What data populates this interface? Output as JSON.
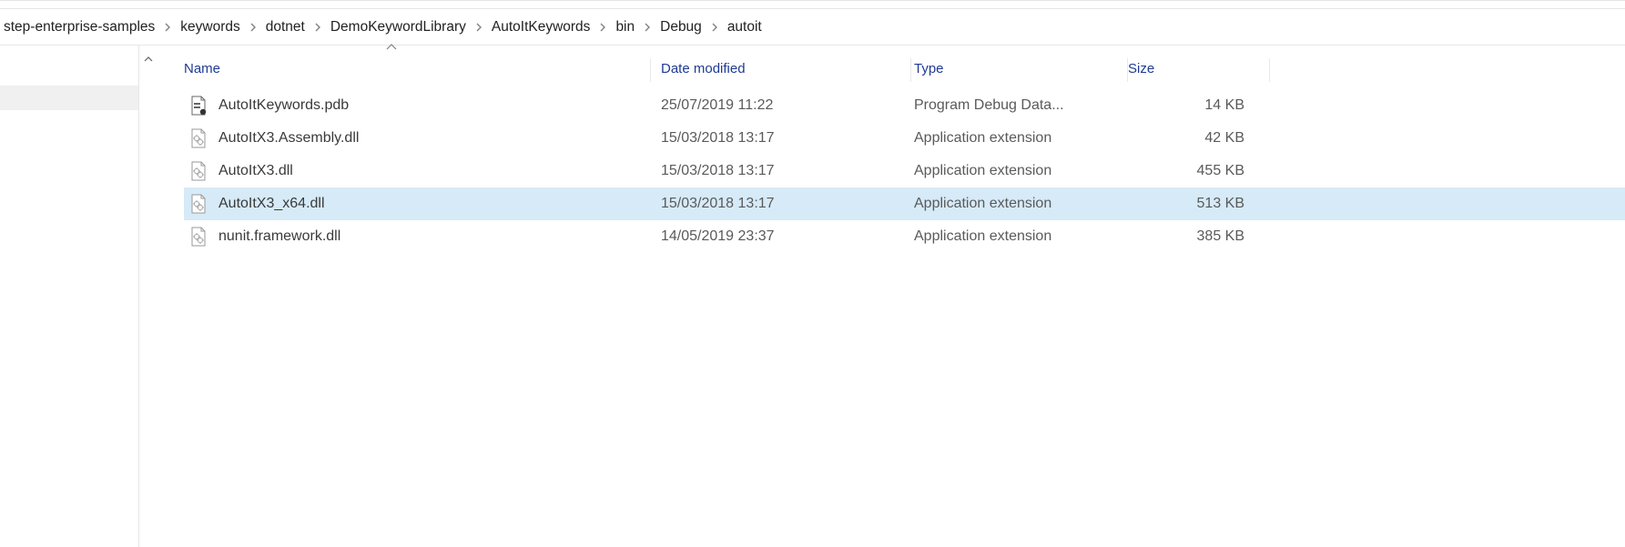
{
  "breadcrumb": [
    "step-enterprise-samples",
    "keywords",
    "dotnet",
    "DemoKeywordLibrary",
    "AutoItKeywords",
    "bin",
    "Debug",
    "autoit"
  ],
  "columns": {
    "name": "Name",
    "date": "Date modified",
    "type": "Type",
    "size": "Size"
  },
  "files": [
    {
      "icon": "pdb",
      "name": "AutoItKeywords.pdb",
      "date": "25/07/2019 11:22",
      "type": "Program Debug Data...",
      "size": "14 KB",
      "selected": false
    },
    {
      "icon": "dll",
      "name": "AutoItX3.Assembly.dll",
      "date": "15/03/2018 13:17",
      "type": "Application extension",
      "size": "42 KB",
      "selected": false
    },
    {
      "icon": "dll",
      "name": "AutoItX3.dll",
      "date": "15/03/2018 13:17",
      "type": "Application extension",
      "size": "455 KB",
      "selected": false
    },
    {
      "icon": "dll",
      "name": "AutoItX3_x64.dll",
      "date": "15/03/2018 13:17",
      "type": "Application extension",
      "size": "513 KB",
      "selected": true
    },
    {
      "icon": "dll",
      "name": "nunit.framework.dll",
      "date": "14/05/2019 23:37",
      "type": "Application extension",
      "size": "385 KB",
      "selected": false
    }
  ]
}
